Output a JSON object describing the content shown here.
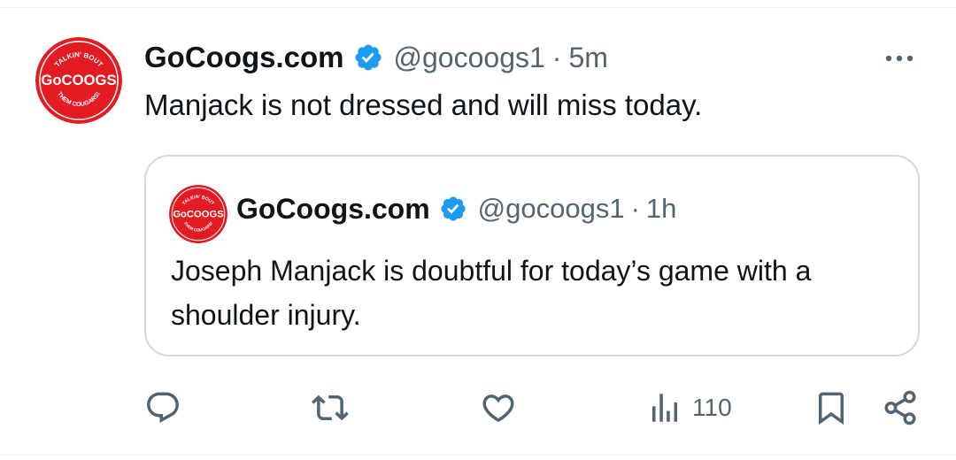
{
  "tweet": {
    "display_name": "GoCoogs.com",
    "handle": "@gocoogs1",
    "separator": "·",
    "time": "5m",
    "text": "Manjack is not dressed and will miss today.",
    "avatar_logo": {
      "top_text": "TALKIN' BOUT",
      "main_text": "GoCOOGS",
      "bottom_text": "THEM COUGARS!"
    }
  },
  "quoted_tweet": {
    "display_name": "GoCoogs.com",
    "handle": "@gocoogs1",
    "separator": "·",
    "time": "1h",
    "text": "Joseph Manjack is doubtful for today’s game with a shoulder injury."
  },
  "actions": {
    "views_count": "110",
    "icons": [
      "reply-icon",
      "retweet-icon",
      "like-icon",
      "views-icon",
      "bookmark-icon",
      "share-icon"
    ]
  },
  "colors": {
    "verified_blue": "#1d9bf0",
    "secondary_text": "#536471",
    "primary_text": "#0f1419",
    "logo_red": "#e31b23",
    "border": "#cfd9de"
  }
}
